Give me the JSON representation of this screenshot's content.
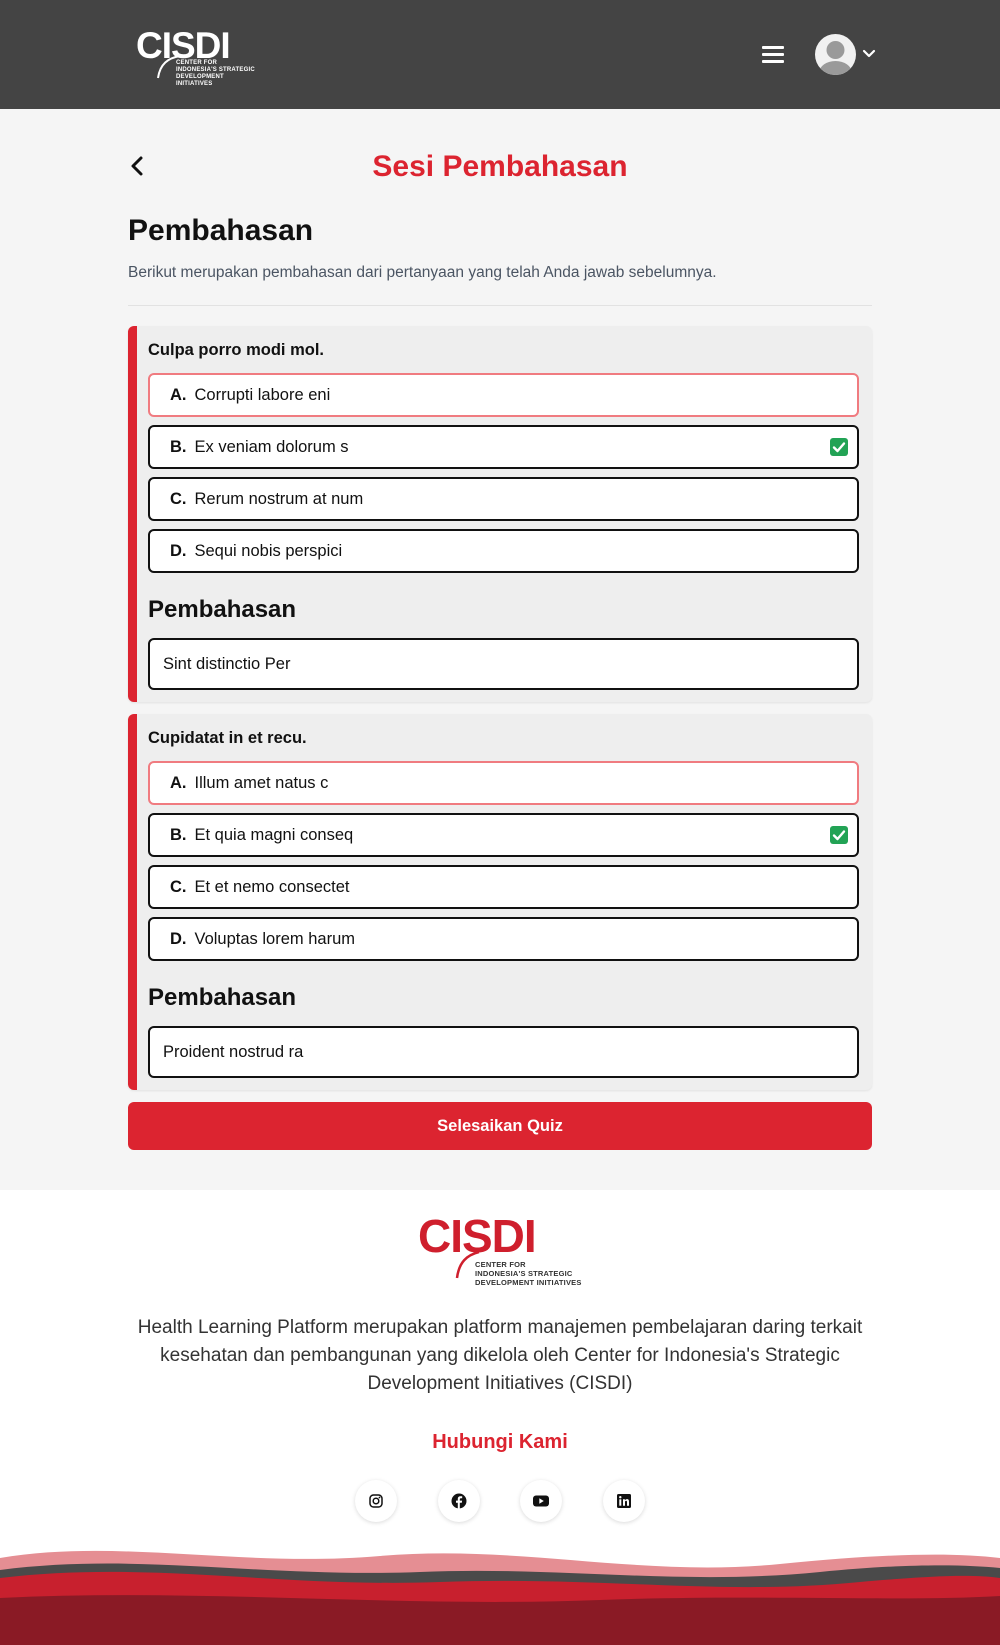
{
  "header": {
    "logo_text": "CISDI",
    "logo_sub": [
      "CENTER FOR",
      "INDONESIA'S STRATEGIC",
      "DEVELOPMENT INITIATIVES"
    ]
  },
  "page": {
    "title": "Sesi Pembahasan",
    "section_title": "Pembahasan",
    "section_desc": "Berikut merupakan pembahasan dari pertanyaan yang telah Anda jawab sebelumnya."
  },
  "questions": [
    {
      "question": "Culpa porro modi mol.",
      "options": [
        {
          "letter": "A.",
          "text": "Corrupti labore eni",
          "state": "wrong"
        },
        {
          "letter": "B.",
          "text": "Ex veniam dolorum s",
          "state": "correct"
        },
        {
          "letter": "C.",
          "text": "Rerum nostrum at num",
          "state": "normal"
        },
        {
          "letter": "D.",
          "text": "Sequi nobis perspici",
          "state": "normal"
        }
      ],
      "explanation_title": "Pembahasan",
      "explanation": "Sint distinctio Per"
    },
    {
      "question": "Cupidatat in et recu.",
      "options": [
        {
          "letter": "A.",
          "text": "Illum amet natus c",
          "state": "wrong"
        },
        {
          "letter": "B.",
          "text": "Et quia magni conseq",
          "state": "correct"
        },
        {
          "letter": "C.",
          "text": "Et et nemo consectet",
          "state": "normal"
        },
        {
          "letter": "D.",
          "text": "Voluptas lorem harum",
          "state": "normal"
        }
      ],
      "explanation_title": "Pembahasan",
      "explanation": "Proident nostrud ra"
    }
  ],
  "finish_button": "Selesaikan Quiz",
  "footer": {
    "logo_text": "CISDI",
    "logo_sub": [
      "CENTER FOR",
      "INDONESIA'S STRATEGIC",
      "DEVELOPMENT INITIATIVES"
    ],
    "description": "Health Learning Platform merupakan platform manajemen pembelajaran daring terkait kesehatan dan pembangunan yang dikelola oleh Center for Indonesia's Strategic Development Initiatives (CISDI)",
    "contact_label": "Hubungi Kami",
    "socials": [
      "instagram-icon",
      "facebook-icon",
      "youtube-icon",
      "linkedin-icon"
    ]
  },
  "colors": {
    "brand_red": "#dc2430",
    "header_bg": "#444444",
    "correct_green": "#22a355",
    "wrong_border": "#f07b80"
  }
}
